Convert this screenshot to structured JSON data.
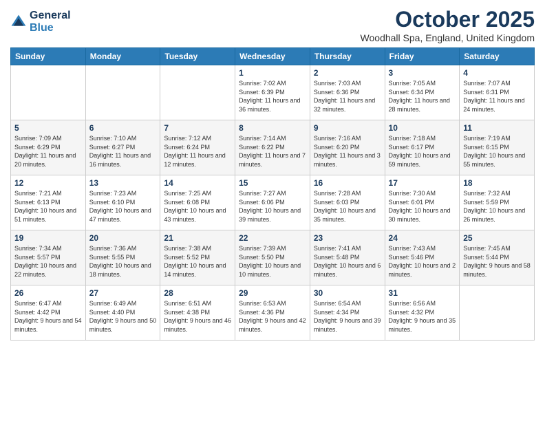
{
  "header": {
    "logo_general": "General",
    "logo_blue": "Blue",
    "month": "October 2025",
    "location": "Woodhall Spa, England, United Kingdom"
  },
  "days_of_week": [
    "Sunday",
    "Monday",
    "Tuesday",
    "Wednesday",
    "Thursday",
    "Friday",
    "Saturday"
  ],
  "weeks": [
    [
      {
        "day": "",
        "info": ""
      },
      {
        "day": "",
        "info": ""
      },
      {
        "day": "",
        "info": ""
      },
      {
        "day": "1",
        "info": "Sunrise: 7:02 AM\nSunset: 6:39 PM\nDaylight: 11 hours\nand 36 minutes."
      },
      {
        "day": "2",
        "info": "Sunrise: 7:03 AM\nSunset: 6:36 PM\nDaylight: 11 hours\nand 32 minutes."
      },
      {
        "day": "3",
        "info": "Sunrise: 7:05 AM\nSunset: 6:34 PM\nDaylight: 11 hours\nand 28 minutes."
      },
      {
        "day": "4",
        "info": "Sunrise: 7:07 AM\nSunset: 6:31 PM\nDaylight: 11 hours\nand 24 minutes."
      }
    ],
    [
      {
        "day": "5",
        "info": "Sunrise: 7:09 AM\nSunset: 6:29 PM\nDaylight: 11 hours\nand 20 minutes."
      },
      {
        "day": "6",
        "info": "Sunrise: 7:10 AM\nSunset: 6:27 PM\nDaylight: 11 hours\nand 16 minutes."
      },
      {
        "day": "7",
        "info": "Sunrise: 7:12 AM\nSunset: 6:24 PM\nDaylight: 11 hours\nand 12 minutes."
      },
      {
        "day": "8",
        "info": "Sunrise: 7:14 AM\nSunset: 6:22 PM\nDaylight: 11 hours\nand 7 minutes."
      },
      {
        "day": "9",
        "info": "Sunrise: 7:16 AM\nSunset: 6:20 PM\nDaylight: 11 hours\nand 3 minutes."
      },
      {
        "day": "10",
        "info": "Sunrise: 7:18 AM\nSunset: 6:17 PM\nDaylight: 10 hours\nand 59 minutes."
      },
      {
        "day": "11",
        "info": "Sunrise: 7:19 AM\nSunset: 6:15 PM\nDaylight: 10 hours\nand 55 minutes."
      }
    ],
    [
      {
        "day": "12",
        "info": "Sunrise: 7:21 AM\nSunset: 6:13 PM\nDaylight: 10 hours\nand 51 minutes."
      },
      {
        "day": "13",
        "info": "Sunrise: 7:23 AM\nSunset: 6:10 PM\nDaylight: 10 hours\nand 47 minutes."
      },
      {
        "day": "14",
        "info": "Sunrise: 7:25 AM\nSunset: 6:08 PM\nDaylight: 10 hours\nand 43 minutes."
      },
      {
        "day": "15",
        "info": "Sunrise: 7:27 AM\nSunset: 6:06 PM\nDaylight: 10 hours\nand 39 minutes."
      },
      {
        "day": "16",
        "info": "Sunrise: 7:28 AM\nSunset: 6:03 PM\nDaylight: 10 hours\nand 35 minutes."
      },
      {
        "day": "17",
        "info": "Sunrise: 7:30 AM\nSunset: 6:01 PM\nDaylight: 10 hours\nand 30 minutes."
      },
      {
        "day": "18",
        "info": "Sunrise: 7:32 AM\nSunset: 5:59 PM\nDaylight: 10 hours\nand 26 minutes."
      }
    ],
    [
      {
        "day": "19",
        "info": "Sunrise: 7:34 AM\nSunset: 5:57 PM\nDaylight: 10 hours\nand 22 minutes."
      },
      {
        "day": "20",
        "info": "Sunrise: 7:36 AM\nSunset: 5:55 PM\nDaylight: 10 hours\nand 18 minutes."
      },
      {
        "day": "21",
        "info": "Sunrise: 7:38 AM\nSunset: 5:52 PM\nDaylight: 10 hours\nand 14 minutes."
      },
      {
        "day": "22",
        "info": "Sunrise: 7:39 AM\nSunset: 5:50 PM\nDaylight: 10 hours\nand 10 minutes."
      },
      {
        "day": "23",
        "info": "Sunrise: 7:41 AM\nSunset: 5:48 PM\nDaylight: 10 hours\nand 6 minutes."
      },
      {
        "day": "24",
        "info": "Sunrise: 7:43 AM\nSunset: 5:46 PM\nDaylight: 10 hours\nand 2 minutes."
      },
      {
        "day": "25",
        "info": "Sunrise: 7:45 AM\nSunset: 5:44 PM\nDaylight: 9 hours\nand 58 minutes."
      }
    ],
    [
      {
        "day": "26",
        "info": "Sunrise: 6:47 AM\nSunset: 4:42 PM\nDaylight: 9 hours\nand 54 minutes."
      },
      {
        "day": "27",
        "info": "Sunrise: 6:49 AM\nSunset: 4:40 PM\nDaylight: 9 hours\nand 50 minutes."
      },
      {
        "day": "28",
        "info": "Sunrise: 6:51 AM\nSunset: 4:38 PM\nDaylight: 9 hours\nand 46 minutes."
      },
      {
        "day": "29",
        "info": "Sunrise: 6:53 AM\nSunset: 4:36 PM\nDaylight: 9 hours\nand 42 minutes."
      },
      {
        "day": "30",
        "info": "Sunrise: 6:54 AM\nSunset: 4:34 PM\nDaylight: 9 hours\nand 39 minutes."
      },
      {
        "day": "31",
        "info": "Sunrise: 6:56 AM\nSunset: 4:32 PM\nDaylight: 9 hours\nand 35 minutes."
      },
      {
        "day": "",
        "info": ""
      }
    ]
  ]
}
